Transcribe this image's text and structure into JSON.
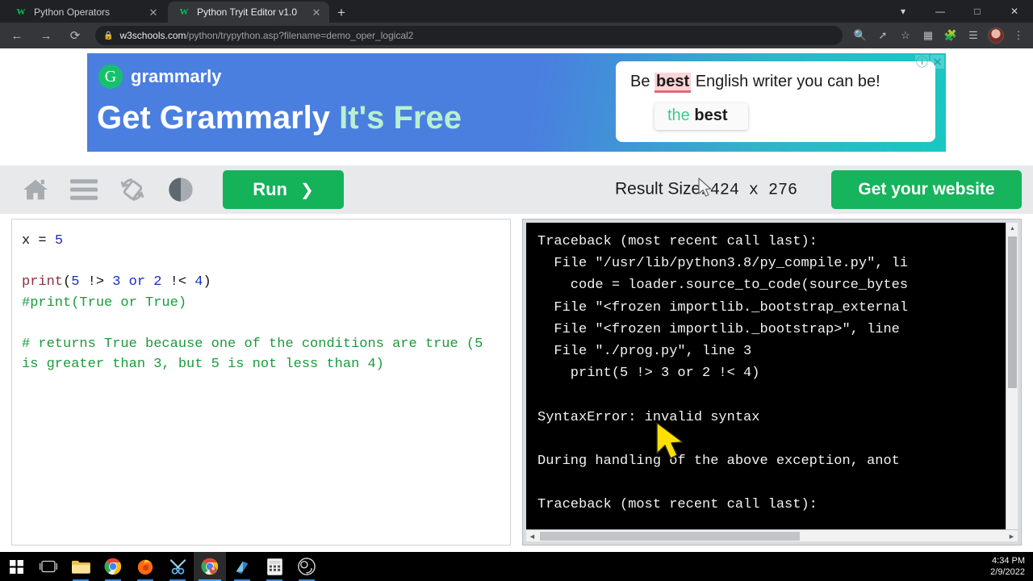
{
  "browser": {
    "tabs": [
      {
        "title": "Python Operators",
        "favicon": "w3schools-icon",
        "active": false
      },
      {
        "title": "Python Tryit Editor v1.0",
        "favicon": "w3schools-icon",
        "active": true
      }
    ],
    "new_tab_label": "+",
    "window_controls": [
      "chevron-down-icon",
      "minimize-icon",
      "maximize-icon",
      "close-icon"
    ],
    "nav": {
      "back": "←",
      "forward": "→",
      "reload": "⟳"
    },
    "address": {
      "lock_icon": "lock-icon",
      "domain": "w3schools.com",
      "path": "/python/trypython.asp?filename=demo_oper_logical2"
    },
    "toolbar_icons": [
      "zoom-icon",
      "share-icon",
      "bookmark-star-icon",
      "reading-list-icon",
      "extensions-puzzle-icon",
      "media-list-icon",
      "profile-avatar",
      "menu-kebab-icon"
    ]
  },
  "ad": {
    "brand": "grammarly",
    "logo_glyph": "G",
    "headline_main": "Get Grammarly ",
    "headline_accent": "It's Free",
    "card": {
      "sentence_before": "Be ",
      "sentence_highlight": "best",
      "sentence_after": " English writer you can be!",
      "suggestion_green": "the ",
      "suggestion_bold": "best"
    },
    "controls": {
      "info": "ⓘ",
      "close": "✕"
    }
  },
  "w3toolbar": {
    "icons": [
      "home-icon",
      "menu-hamburger-icon",
      "rotate-layout-icon",
      "theme-contrast-icon"
    ],
    "run_label": "Run",
    "run_chevron": "❯",
    "result_size_label": "Result Size:",
    "result_width": "424",
    "result_separator": "x",
    "result_height": "276",
    "get_website_label": "Get your website"
  },
  "editor": {
    "lines": [
      {
        "segments": [
          {
            "t": "x = ",
            "c": "plain"
          },
          {
            "t": "5",
            "c": "num"
          }
        ]
      },
      {
        "segments": [
          {
            "t": "",
            "c": "plain"
          }
        ]
      },
      {
        "segments": [
          {
            "t": "print",
            "c": "fn"
          },
          {
            "t": "(",
            "c": "plain"
          },
          {
            "t": "5",
            "c": "num"
          },
          {
            "t": " !> ",
            "c": "plain"
          },
          {
            "t": "3",
            "c": "num"
          },
          {
            "t": " ",
            "c": "plain"
          },
          {
            "t": "or",
            "c": "op"
          },
          {
            "t": " ",
            "c": "plain"
          },
          {
            "t": "2",
            "c": "num"
          },
          {
            "t": " !< ",
            "c": "plain"
          },
          {
            "t": "4",
            "c": "num"
          },
          {
            "t": ")",
            "c": "plain"
          }
        ]
      },
      {
        "segments": [
          {
            "t": "#print(True or True)",
            "c": "com"
          }
        ]
      },
      {
        "segments": [
          {
            "t": "",
            "c": "plain"
          }
        ]
      },
      {
        "segments": [
          {
            "t": "# returns True because one of the conditions are true (5 is greater than 3, but 5 is not less than 4)",
            "c": "com"
          }
        ]
      }
    ]
  },
  "terminal": {
    "output": "Traceback (most recent call last):\n  File \"/usr/lib/python3.8/py_compile.py\", li\n    code = loader.source_to_code(source_bytes\n  File \"<frozen importlib._bootstrap_external\n  File \"<frozen importlib._bootstrap>\", line\n  File \"./prog.py\", line 3\n    print(5 !> 3 or 2 !< 4)\n\nSyntaxError: invalid syntax\n\nDuring handling of the above exception, anot\n\nTraceback (most recent call last):",
    "scroll_up": "▲",
    "scroll_down": "▼",
    "scroll_left": "◀",
    "scroll_right": "▶"
  },
  "taskbar": {
    "items": [
      "start-windows-icon",
      "task-view-icon",
      "file-explorer-icon",
      "chrome-icon",
      "firefox-icon",
      "snipping-tool-icon",
      "chrome-active-icon",
      "store-icon",
      "calculator-icon",
      "obs-icon"
    ],
    "time": "4:34 PM",
    "date": "2/9/2022"
  },
  "colors": {
    "accent_green": "#16b45c",
    "ad_blue": "#4a7fe0",
    "terminal_bg": "#000000",
    "toolbar_gray": "#e7e9eb"
  }
}
